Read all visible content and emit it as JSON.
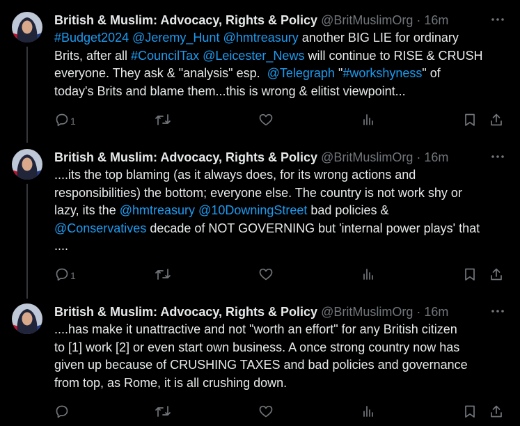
{
  "colors": {
    "background": "#000000",
    "text": "#e7e9ea",
    "muted": "#71767b",
    "link": "#1d9bf0"
  },
  "icons": [
    "more-icon",
    "reply-icon",
    "retweet-icon",
    "like-icon",
    "views-icon",
    "bookmark-icon",
    "share-icon"
  ],
  "tweets": [
    {
      "name": "British & Muslim: Advocacy, Rights & Policy",
      "handle": "@BritMuslimOrg",
      "dot": "·",
      "time": "16m",
      "body": {
        "l1": {
          "a": "#Budget2024",
          "b": "@Jeremy_Hunt",
          "c": "@hmtreasury",
          "d": " another BIG LIE for ordinary"
        },
        "l2": {
          "a": "Brits, after all ",
          "b": "#CouncilTax",
          "c": "@Leicester_News",
          "d": " will continue to RISE & CRUSH"
        },
        "l3": {
          "a": "everyone. They ask & \"analysis\" esp.  ",
          "b": "@Telegraph",
          "c": " \"",
          "d": "#workshyness",
          "e": "\" of"
        },
        "l4": {
          "a": "today's Brits and blame them...this is wrong & elitist viewpoint..."
        }
      },
      "replies": "1"
    },
    {
      "name": "British & Muslim: Advocacy, Rights & Policy",
      "handle": "@BritMuslimOrg",
      "dot": "·",
      "time": "16m",
      "body": {
        "l1": {
          "a": "....its the top blaming (as it always does, for its wrong actions and"
        },
        "l2": {
          "a": "responsibilities) the bottom; everyone else. The country is not work shy or"
        },
        "l3": {
          "a": "lazy, its the ",
          "b": "@hmtreasury",
          "c": "@10DowningStreet",
          "d": " bad policies &"
        },
        "l4": {
          "a": "@Conservatives",
          "b": " decade of NOT GOVERNING but 'internal power plays' that"
        },
        "l5": {
          "a": "...."
        }
      },
      "replies": "1"
    },
    {
      "name": "British & Muslim: Advocacy, Rights & Policy",
      "handle": "@BritMuslimOrg",
      "dot": "·",
      "time": "16m",
      "body": {
        "l1": {
          "a": "....has make it unattractive and not \"worth an effort\" for any British citizen"
        },
        "l2": {
          "a": "to [1] work [2] or even start own business. A once strong country now has"
        },
        "l3": {
          "a": "given up because of CRUSHING TAXES and bad policies and governance"
        },
        "l4": {
          "a": "from top, as Rome, it is all crushing down."
        }
      },
      "replies": ""
    }
  ]
}
